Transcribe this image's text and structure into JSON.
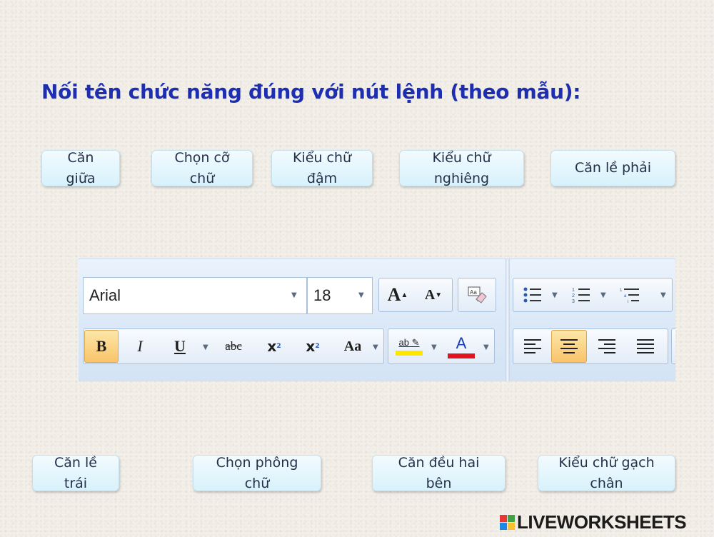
{
  "heading": "Nối tên chức năng đúng với nút lệnh (theo mẫu):",
  "cards_top": [
    "Căn giữa",
    "Chọn cỡ chữ",
    "Kiểu chữ đậm",
    "Kiểu chữ nghiêng",
    "Căn lề phải"
  ],
  "cards_bottom": [
    "Căn lề trái",
    "Chọn phông chữ",
    "Căn đều hai bên",
    "Kiểu chữ gạch chân"
  ],
  "ribbon": {
    "font_name": "Arial",
    "font_size": "18",
    "grow_font_glyph": "A",
    "shrink_font_glyph": "A",
    "bold": "B",
    "italic": "I",
    "underline": "U",
    "strikethrough": "abc",
    "subscript": "x",
    "subscript_mark": "2",
    "superscript": "x",
    "superscript_mark": "2",
    "change_case": "Aa",
    "highlight": "ab",
    "font_color": "A",
    "active_buttons": [
      "bold",
      "align-center"
    ],
    "highlight_color": "#ffe600",
    "font_color_bar": "#e0141e"
  },
  "branding": {
    "site": "LIVEWORKSHEETS"
  },
  "colors": {
    "heading": "#1d2fb0",
    "card_bg": "#e6f6fc",
    "active_button": "#f9c46b"
  }
}
